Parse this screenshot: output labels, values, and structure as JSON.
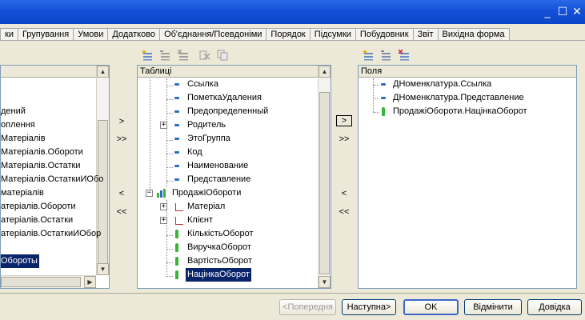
{
  "window": {
    "minimize": "_",
    "maximize": "☐",
    "close": "✕"
  },
  "tabs": [
    "ки",
    "Групування",
    "Умови",
    "Додатково",
    "Об'єднання/Псевдоніми",
    "Порядок",
    "Підсумки",
    "Побудовник",
    "Звіт",
    "Вихідна форма"
  ],
  "left_panel": {
    "items": [
      "дений",
      "оплення",
      "Матеріалів",
      "Матеріалів.Обороти",
      "Матеріалів.Остатки",
      "Матеріалів.ОстаткиИОбо",
      "матеріалів",
      "атеріалів.Обороти",
      "атеріалів.Остатки",
      "атеріалів.ОстаткиИОбор",
      "",
      "Обороты"
    ],
    "selected_index": 11
  },
  "middle_panel": {
    "header": "Таблиці",
    "fields": [
      "Ссылка",
      "ПометкаУдаления",
      "Предопределенный",
      "Родитель",
      "ЭтоГруппа",
      "Код",
      "Наименование",
      "Представление"
    ],
    "table_name": "ПродажіОбороти",
    "dimensions": [
      "Матеріал",
      "Клієнт"
    ],
    "resources": [
      "КількістьОборот",
      "ВиручкаОборот",
      "ВартістьОборот",
      "НацінкаОборот"
    ],
    "selected": "НацінкаОборот"
  },
  "transfer_buttons": {
    "tables": {
      "add_one": ">",
      "add_all": ">>",
      "remove_one": "<",
      "remove_all": "<<"
    },
    "fields": {
      "add_one": ">",
      "add_all": ">>",
      "remove_one": "<",
      "remove_all": "<<"
    }
  },
  "right_panel": {
    "header": "Поля",
    "items": [
      "ДНоменклатура.Ссылка",
      "ДНоменклатура.Представление",
      "ПродажіОбороти.НацінкаОборот"
    ]
  },
  "buttons": {
    "prev": "<Попередня",
    "next": "Наступна>",
    "ok": "OK",
    "cancel": "Відмінити",
    "help": "Довідка"
  },
  "colors": {
    "title_bar": "#1550d8",
    "selection": "#0a246a",
    "field_icon": "#2b6fc5",
    "resource_icon": "#3bb238"
  }
}
